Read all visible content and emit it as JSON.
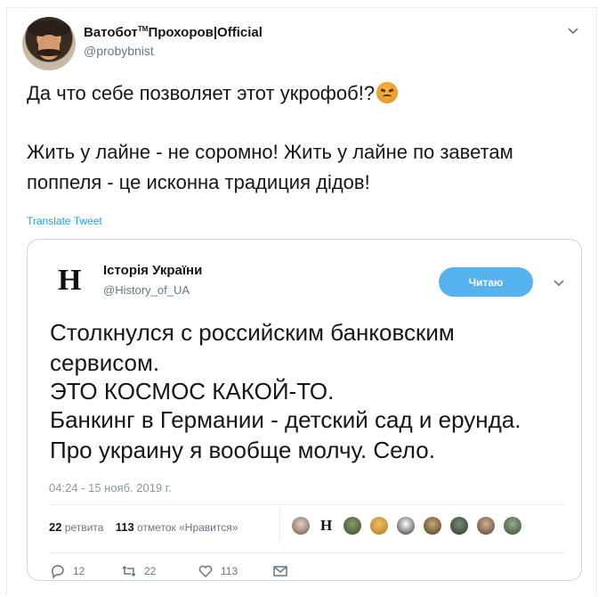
{
  "tweet": {
    "author_name": "Ватобот",
    "author_tm": "TM",
    "author_name_suffix": "Прохоров|Official",
    "author_handle": "@probybnist",
    "text_line1": "Да что себе позволяет этот укрофоб!?",
    "text_line2": "Жить у лайне - не соромно! Жить у лайне по заветам",
    "text_line3": "поппеля - це исконна традиция дідов!",
    "translate_label": "Translate Tweet"
  },
  "quoted": {
    "logo_letter": "H",
    "name": "Історія України",
    "handle": "@History_of_UA",
    "follow_label": "Читаю",
    "lines": [
      "Столкнулся с российским банковским",
      "сервисом.",
      "ЭТО КОСМОС КАКОЙ-ТО.",
      "Банкинг в Германии - детский сад и ерунда.",
      "Про украину я вообще молчу. Село."
    ],
    "timestamp": "04:24 - 15 нояб. 2019 г.",
    "retweets_count": "22",
    "retweets_label": "ретвита",
    "likes_count": "113",
    "likes_label": "отметок «Нравится»",
    "likers_logo": "H",
    "actions": {
      "replies": "12",
      "retweets": "22",
      "likes": "113"
    }
  },
  "colors": {
    "accent": "#1da1f2",
    "follow_bg": "#56b2ee",
    "muted": "#657786"
  }
}
